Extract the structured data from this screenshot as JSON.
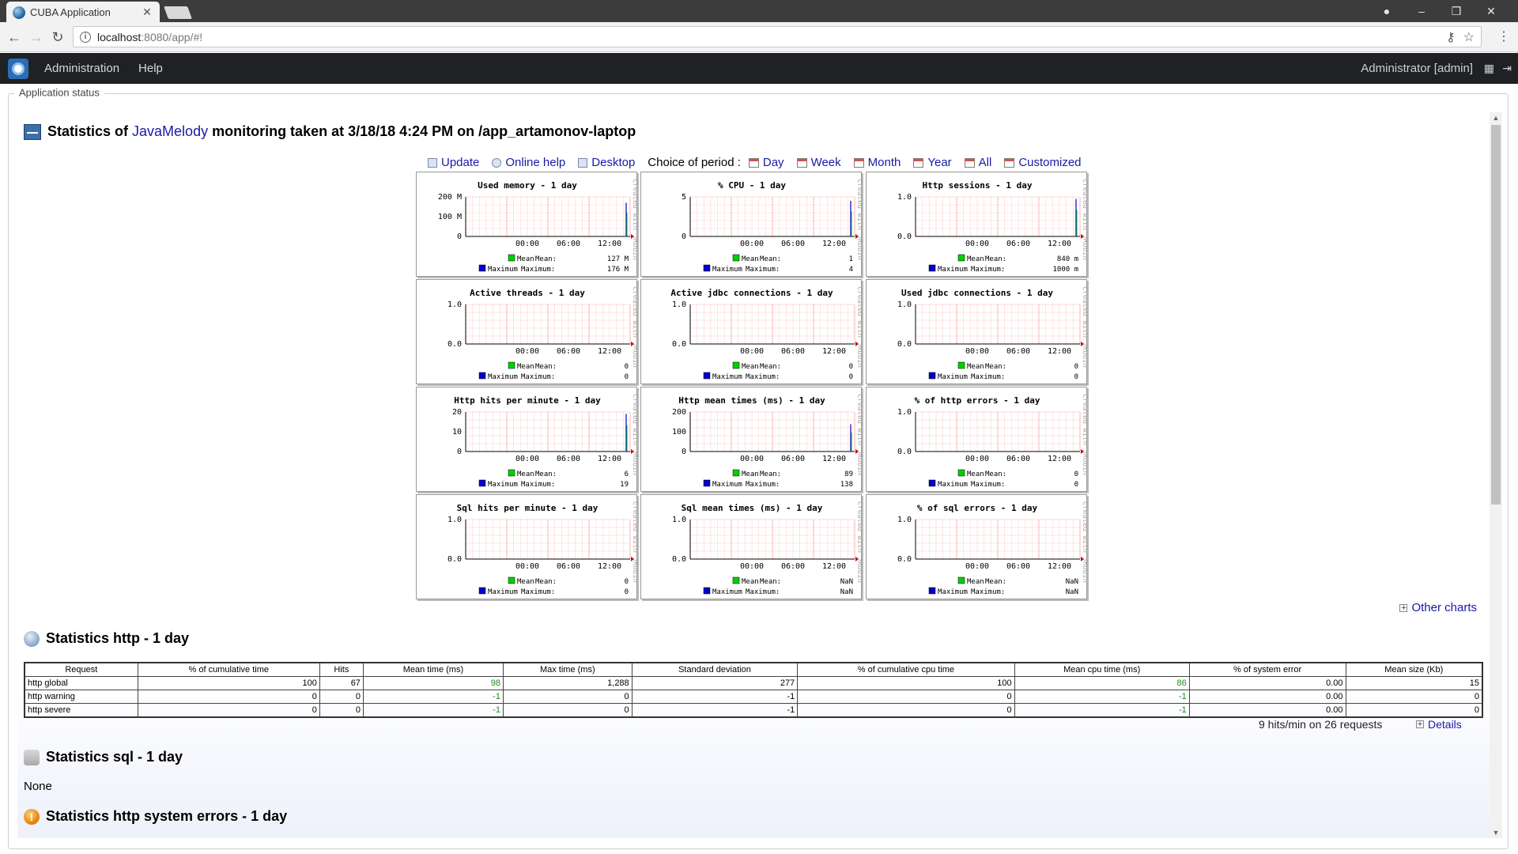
{
  "browser": {
    "tab_title": "CUBA Application",
    "url_host": "localhost",
    "url_rest": ":8080/app/#!"
  },
  "app": {
    "menu": [
      "Administration",
      "Help"
    ],
    "user": "Administrator [admin]"
  },
  "panel": {
    "legend": "Application status"
  },
  "stats": {
    "title_prefix": "Statistics of",
    "title_link": "JavaMelody",
    "title_suffix": "monitoring taken at 3/18/18 4:24 PM on /app_artamonov-laptop"
  },
  "toolbar": {
    "update": "Update",
    "online_help": "Online help",
    "desktop": "Desktop",
    "period_label": "Choice of period :",
    "periods": [
      "Day",
      "Week",
      "Month",
      "Year",
      "All",
      "Customized"
    ]
  },
  "chart_data": [
    {
      "type": "line",
      "title": "Used memory - 1 day",
      "yticks": [
        "200 M",
        "100 M",
        "0"
      ],
      "xticks": [
        "00:00",
        "06:00",
        "12:00"
      ],
      "legend": [
        "Mean",
        "Maximum"
      ],
      "mean_value": "127 M",
      "max_value": "176 M",
      "spike": 0.85
    },
    {
      "type": "line",
      "title": "% CPU - 1 day",
      "yticks": [
        "5",
        "",
        "0"
      ],
      "xticks": [
        "00:00",
        "06:00",
        "12:00"
      ],
      "legend": [
        "Mean",
        "Maximum"
      ],
      "mean_value": "1",
      "max_value": "4",
      "spike": 0.9
    },
    {
      "type": "line",
      "title": "Http sessions - 1 day",
      "yticks": [
        "1.0",
        "",
        "0.0"
      ],
      "xticks": [
        "00:00",
        "06:00",
        "12:00"
      ],
      "legend": [
        "Mean",
        "Maximum"
      ],
      "mean_value": "840 m",
      "max_value": "1000 m",
      "spike": 0.95
    },
    {
      "type": "line",
      "title": "Active threads - 1 day",
      "yticks": [
        "1.0",
        "",
        "0.0"
      ],
      "xticks": [
        "00:00",
        "06:00",
        "12:00"
      ],
      "legend": [
        "Mean",
        "Maximum"
      ],
      "mean_value": "0",
      "max_value": "0",
      "spike": 0
    },
    {
      "type": "line",
      "title": "Active jdbc connections - 1 day",
      "yticks": [
        "1.0",
        "",
        "0.0"
      ],
      "xticks": [
        "00:00",
        "06:00",
        "12:00"
      ],
      "legend": [
        "Mean",
        "Maximum"
      ],
      "mean_value": "0",
      "max_value": "0",
      "spike": 0
    },
    {
      "type": "line",
      "title": "Used jdbc connections - 1 day",
      "yticks": [
        "1.0",
        "",
        "0.0"
      ],
      "xticks": [
        "00:00",
        "06:00",
        "12:00"
      ],
      "legend": [
        "Mean",
        "Maximum"
      ],
      "mean_value": "0",
      "max_value": "0",
      "spike": 0
    },
    {
      "type": "line",
      "title": "Http hits per minute - 1 day",
      "yticks": [
        "20",
        "10",
        "0"
      ],
      "xticks": [
        "00:00",
        "06:00",
        "12:00"
      ],
      "legend": [
        "Mean",
        "Maximum"
      ],
      "mean_value": "6",
      "max_value": "19",
      "spike": 0.95
    },
    {
      "type": "line",
      "title": "Http mean times (ms) - 1 day",
      "yticks": [
        "200",
        "100",
        "0"
      ],
      "xticks": [
        "00:00",
        "06:00",
        "12:00"
      ],
      "legend": [
        "Mean",
        "Maximum"
      ],
      "mean_value": "89",
      "max_value": "138",
      "spike": 0.69
    },
    {
      "type": "line",
      "title": "% of http errors - 1 day",
      "yticks": [
        "1.0",
        "",
        "0.0"
      ],
      "xticks": [
        "00:00",
        "06:00",
        "12:00"
      ],
      "legend": [
        "Mean",
        "Maximum"
      ],
      "mean_value": "0",
      "max_value": "0",
      "spike": 0
    },
    {
      "type": "line",
      "title": "Sql hits per minute - 1 day",
      "yticks": [
        "1.0",
        "",
        "0.0"
      ],
      "xticks": [
        "00:00",
        "06:00",
        "12:00"
      ],
      "legend": [
        "Mean",
        "Maximum"
      ],
      "mean_value": "0",
      "max_value": "0",
      "spike": 0
    },
    {
      "type": "line",
      "title": "Sql mean times (ms) - 1 day",
      "yticks": [
        "1.0",
        "",
        "0.0"
      ],
      "xticks": [
        "00:00",
        "06:00",
        "12:00"
      ],
      "legend": [
        "Mean",
        "Maximum"
      ],
      "mean_value": "NaN",
      "max_value": "NaN",
      "spike": 0
    },
    {
      "type": "line",
      "title": "% of sql errors - 1 day",
      "yticks": [
        "1.0",
        "",
        "0.0"
      ],
      "xticks": [
        "00:00",
        "06:00",
        "12:00"
      ],
      "legend": [
        "Mean",
        "Maximum"
      ],
      "mean_value": "NaN",
      "max_value": "NaN",
      "spike": 0
    }
  ],
  "chart_side_text": "Created with JRobin",
  "chart_colors": {
    "mean": "#00d000",
    "maximum": "#0000cc",
    "grid": "#ff9999"
  },
  "other_charts": "Other charts",
  "http_section": {
    "title": "Statistics http - 1 day",
    "columns": [
      "Request",
      "% of cumulative time",
      "Hits",
      "Mean time (ms)",
      "Max time (ms)",
      "Standard deviation",
      "% of cumulative cpu time",
      "Mean cpu time (ms)",
      "% of system error",
      "Mean size (Kb)"
    ],
    "rows": [
      [
        "http global",
        "100",
        "67",
        "98",
        "1,288",
        "277",
        "100",
        "86",
        "0.00",
        "15"
      ],
      [
        "http warning",
        "0",
        "0",
        "-1",
        "0",
        "-1",
        "0",
        "-1",
        "0.00",
        "0"
      ],
      [
        "http severe",
        "0",
        "0",
        "-1",
        "0",
        "-1",
        "0",
        "-1",
        "0.00",
        "0"
      ]
    ],
    "summary": "9 hits/min on 26 requests",
    "details": "Details"
  },
  "sql_section": {
    "title": "Statistics sql - 1 day",
    "none": "None"
  },
  "errors_section": {
    "title": "Statistics http system errors - 1 day"
  },
  "icons": {
    "back": "back-arrow-icon",
    "forward": "forward-arrow-icon",
    "reload": "reload-icon",
    "account": "account-icon",
    "key": "key-icon",
    "star": "star-icon"
  }
}
